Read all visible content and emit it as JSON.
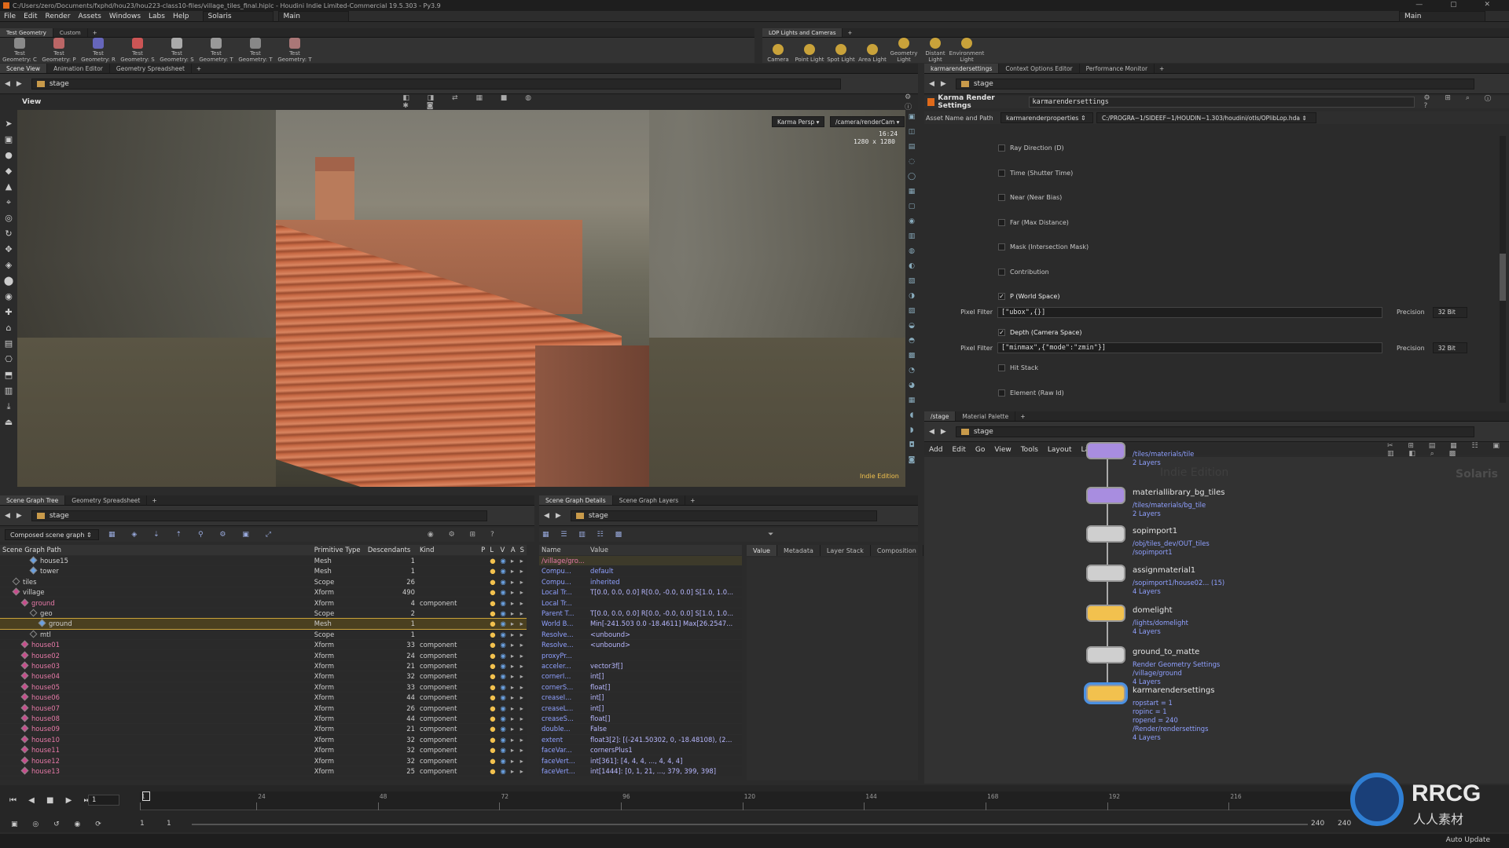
{
  "titlebar": {
    "path": "C:/Users/zero/Documents/fxphd/hou23/hou223-class10-files/village_tiles_final.hiplc - Houdini Indie Limited-Commercial 19.5.303 - Py3.9"
  },
  "menubar": {
    "items": [
      "File",
      "Edit",
      "Render",
      "Assets",
      "Windows",
      "Labs",
      "Help"
    ],
    "desktop": "Solaris",
    "context": "Main",
    "right_context": "Main"
  },
  "shelf_left": {
    "tabs": [
      "Test Geometry",
      "Custom"
    ],
    "tools": [
      "Test Geometry: C",
      "Test Geometry: P",
      "Test Geometry: R",
      "Test Geometry: S",
      "Test Geometry: S",
      "Test Geometry: T",
      "Test Geometry: T",
      "Test Geometry: T"
    ]
  },
  "shelf_right": {
    "tabs": [
      "LOP Lights and Cameras"
    ],
    "tools": [
      "Camera",
      "Point Light",
      "Spot Light",
      "Area Light",
      "Geometry Light",
      "Distant Light",
      "Environment Light"
    ]
  },
  "viewer": {
    "tabs": [
      "Scene View",
      "Animation Editor",
      "Geometry Spreadsheet"
    ],
    "path": "stage",
    "label": "View",
    "renderer": "Karma Persp",
    "camera": "/camera/renderCam",
    "aspect": "16:24",
    "resolution": "1280 x 1280",
    "watermark": "Indie Edition"
  },
  "params": {
    "tabs": [
      "karmarendersettings",
      "Context Options Editor",
      "Performance Monitor"
    ],
    "path": "stage",
    "node_type": "Karma Render Settings",
    "node_name": "karmarendersettings",
    "asset_label": "Asset Name and Path",
    "asset_name": "karmarenderproperties",
    "asset_path": "C:/PROGRA~1/SIDEEF~1/HOUDIN~1.303/houdini/otls/OPlibLop.hda",
    "rows": [
      {
        "label": "Ray Direction (D)",
        "checked": false
      },
      {
        "label": "Time (Shutter Time)",
        "checked": false
      },
      {
        "label": "Near (Near Bias)",
        "checked": false
      },
      {
        "label": "Far (Max Distance)",
        "checked": false
      },
      {
        "label": "Mask (Intersection Mask)",
        "checked": false
      },
      {
        "label": "Contribution",
        "checked": false
      },
      {
        "label": "P (World Space)",
        "checked": true
      },
      {
        "label": "Depth (Camera Space)",
        "checked": true
      },
      {
        "label": "Hit Stack",
        "checked": false
      },
      {
        "label": "Element (Raw Id)",
        "checked": false
      }
    ],
    "pixel_filter_label": "Pixel Filter",
    "pf1": "[\"ubox\",{}]",
    "pf2": "[\"minmax\",{\"mode\":\"zmin\"}]",
    "precision_label": "Precision",
    "precision": "32 Bit"
  },
  "scene_graph": {
    "tabs": [
      "Scene Graph Tree",
      "Geometry Spreadsheet"
    ],
    "path": "stage",
    "filter": "Composed scene graph",
    "headers": [
      "Scene Graph Path",
      "Primitive Type",
      "Descendants",
      "Kind",
      "P",
      "L",
      "V",
      "A",
      "S"
    ],
    "rows": [
      {
        "name": "house15",
        "type": "Mesh",
        "desc": "1",
        "kind": ""
      },
      {
        "name": "tower",
        "type": "Mesh",
        "desc": "1",
        "kind": ""
      },
      {
        "name": "tiles",
        "type": "Scope",
        "desc": "26",
        "kind": ""
      },
      {
        "name": "village",
        "type": "Xform",
        "desc": "490",
        "kind": ""
      },
      {
        "name": "ground",
        "type": "Xform",
        "desc": "4",
        "kind": "component"
      },
      {
        "name": "geo",
        "type": "Scope",
        "desc": "2",
        "kind": ""
      },
      {
        "name": "ground",
        "type": "Mesh",
        "desc": "1",
        "kind": ""
      },
      {
        "name": "mtl",
        "type": "Scope",
        "desc": "1",
        "kind": ""
      },
      {
        "name": "house01",
        "type": "Xform",
        "desc": "33",
        "kind": "component"
      },
      {
        "name": "house02",
        "type": "Xform",
        "desc": "24",
        "kind": "component"
      },
      {
        "name": "house03",
        "type": "Xform",
        "desc": "21",
        "kind": "component"
      },
      {
        "name": "house04",
        "type": "Xform",
        "desc": "32",
        "kind": "component"
      },
      {
        "name": "house05",
        "type": "Xform",
        "desc": "33",
        "kind": "component"
      },
      {
        "name": "house06",
        "type": "Xform",
        "desc": "44",
        "kind": "component"
      },
      {
        "name": "house07",
        "type": "Xform",
        "desc": "26",
        "kind": "component"
      },
      {
        "name": "house08",
        "type": "Xform",
        "desc": "44",
        "kind": "component"
      },
      {
        "name": "house09",
        "type": "Xform",
        "desc": "21",
        "kind": "component"
      },
      {
        "name": "house10",
        "type": "Xform",
        "desc": "32",
        "kind": "component"
      },
      {
        "name": "house11",
        "type": "Xform",
        "desc": "32",
        "kind": "component"
      },
      {
        "name": "house12",
        "type": "Xform",
        "desc": "32",
        "kind": "component"
      },
      {
        "name": "house13",
        "type": "Xform",
        "desc": "25",
        "kind": "component"
      }
    ]
  },
  "details": {
    "tabs": [
      "Scene Graph Details",
      "Scene Graph Layers"
    ],
    "path": "stage",
    "headers": [
      "Name",
      "Value"
    ],
    "side_tabs": [
      "Value",
      "Metadata",
      "Layer Stack",
      "Composition"
    ],
    "rows": [
      {
        "name": "/village/gro...",
        "value": ""
      },
      {
        "name": "Compu...",
        "value": "default"
      },
      {
        "name": "Compu...",
        "value": "inherited"
      },
      {
        "name": "Local Tr...",
        "value": "T[0.0, 0.0, 0.0] R[0.0, -0.0, 0.0] S[1.0, 1.0..."
      },
      {
        "name": "Local Tr...",
        "value": ""
      },
      {
        "name": "Parent T...",
        "value": "T[0.0, 0.0, 0.0] R[0.0, -0.0, 0.0] S[1.0, 1.0..."
      },
      {
        "name": "World B...",
        "value": "Min[-241.503 0.0 -18.4611] Max[26.2547..."
      },
      {
        "name": "Resolve...",
        "value": "<unbound>"
      },
      {
        "name": "Resolve...",
        "value": "<unbound>"
      },
      {
        "name": "proxyPr...",
        "value": ""
      },
      {
        "name": "acceler...",
        "value": "vector3f[]"
      },
      {
        "name": "cornerI...",
        "value": "int[]"
      },
      {
        "name": "cornerS...",
        "value": "float[]"
      },
      {
        "name": "creaseI...",
        "value": "int[]"
      },
      {
        "name": "creaseL...",
        "value": "int[]"
      },
      {
        "name": "creaseS...",
        "value": "float[]"
      },
      {
        "name": "double...",
        "value": "False"
      },
      {
        "name": "extent",
        "value": "float3[2]: [(-241.50302, 0, -18.48108), (2..."
      },
      {
        "name": "faceVar...",
        "value": "cornersPlus1"
      },
      {
        "name": "faceVert...",
        "value": "int[361]: [4, 4, 4, ..., 4, 4, 4]"
      },
      {
        "name": "faceVert...",
        "value": "int[1444]: [0, 1, 21, ..., 379, 399, 398]"
      },
      {
        "name": "holeInd...",
        "value": "int[]"
      }
    ]
  },
  "network": {
    "tabs": [
      "/stage",
      "Material Palette"
    ],
    "path": "stage",
    "menu": [
      "Add",
      "Edit",
      "Go",
      "View",
      "Tools",
      "Layout",
      "Labs",
      "Help"
    ],
    "context_label": "Solaris",
    "watermark": "Indie Edition",
    "nodes": [
      {
        "name": "",
        "sub": [
          "/tiles/materials/tile",
          "2 Layers"
        ]
      },
      {
        "name": "materiallibrary_bg_tiles",
        "sub": [
          "/tiles/materials/bg_tile",
          "2 Layers"
        ]
      },
      {
        "name": "sopimport1",
        "sub": [
          "/obj/tiles_dev/OUT_tiles",
          "/sopimport1"
        ]
      },
      {
        "name": "assignmaterial1",
        "sub": [
          "/sopimport1/house02... (15)",
          "4 Layers"
        ]
      },
      {
        "name": "domelight",
        "sub": [
          "/lights/domelight",
          "4 Layers"
        ]
      },
      {
        "name": "ground_to_matte",
        "sub": [
          "Render Geometry Settings",
          "/village/ground",
          "4 Layers"
        ]
      },
      {
        "name": "karmarendersettings",
        "sub": [
          "ropstart = 1",
          "ropinc = 1",
          "ropend = 240",
          "/Render/rendersettings",
          "4 Layers"
        ]
      }
    ]
  },
  "timeline": {
    "ticks": [
      "1",
      "24",
      "48",
      "72",
      "96",
      "120",
      "144",
      "168",
      "192",
      "216"
    ],
    "current_frame": "1",
    "start": "1",
    "start2": "1",
    "end": "240",
    "end2": "240",
    "auto_update": "Auto Update"
  },
  "logo": {
    "text": "RRCG",
    "sub": "人人素材"
  }
}
